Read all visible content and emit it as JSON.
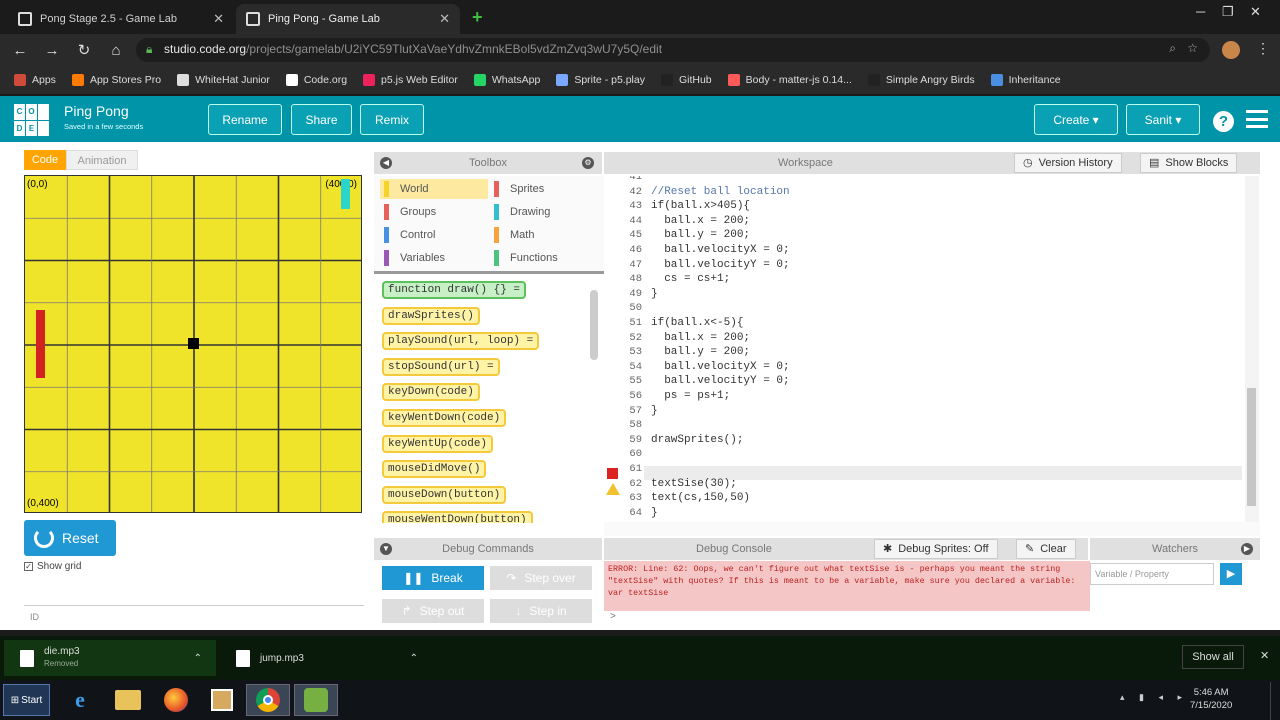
{
  "browser": {
    "tabs": [
      {
        "title": "Pong Stage 2.5 - Game Lab",
        "active": false
      },
      {
        "title": "Ping Pong - Game Lab",
        "active": true
      }
    ],
    "new_tab_label": "+",
    "url_host": "studio.code.org",
    "url_path": "/projects/gamelab/U2iYC59TlutXaVaeYdhvZmnkEBol5vdZmZvq3wU7y5Q/edit",
    "bookmarks": [
      {
        "label": "Apps",
        "icon": "apps-grid-icon",
        "color": "#d04a3a"
      },
      {
        "label": "App Stores Pro",
        "icon": "appstore-icon",
        "color": "#ff7a00"
      },
      {
        "label": "WhiteHat Junior",
        "icon": "whitehat-icon",
        "color": "#dddddd"
      },
      {
        "label": "Code.org",
        "icon": "codeorg-icon",
        "color": "#ffffff"
      },
      {
        "label": "p5.js Web Editor",
        "icon": "p5js-icon",
        "color": "#ed225d"
      },
      {
        "label": "WhatsApp",
        "icon": "whatsapp-icon",
        "color": "#25d366"
      },
      {
        "label": "Sprite - p5.play",
        "icon": "p5play-icon",
        "color": "#7aa7ff"
      },
      {
        "label": "GitHub",
        "icon": "github-icon",
        "color": "#222222"
      },
      {
        "label": "Body - matter-js 0.14...",
        "icon": "matterjs-icon",
        "color": "#ff5a5a"
      },
      {
        "label": "Simple Angry Birds",
        "icon": "github-icon",
        "color": "#222222"
      },
      {
        "label": "Inheritance",
        "icon": "inheritance-icon",
        "color": "#4a90e2"
      }
    ]
  },
  "header": {
    "project_name": "Ping Pong",
    "saved_status": "Saved in a few seconds",
    "buttons": {
      "rename": "Rename",
      "share": "Share",
      "remix": "Remix",
      "create": "Create ▾",
      "user": "Sanit ▾"
    },
    "help": "?",
    "logo_letters": [
      "C",
      "O",
      "",
      "D",
      "E",
      ""
    ]
  },
  "left_panel": {
    "tabs": {
      "code": "Code",
      "animation": "Animation"
    },
    "coords": {
      "top_left": "(0,0)",
      "top_right": "(400,0)",
      "bottom_left": "(0,400)"
    },
    "reset_label": "Reset",
    "show_grid_label": "Show grid",
    "show_grid_checked": true,
    "id_icon": "ID"
  },
  "toolbox": {
    "title": "Toolbox",
    "categories": [
      {
        "label": "World",
        "color": "#f5d328",
        "selected": true
      },
      {
        "label": "Sprites",
        "color": "#e8605a"
      },
      {
        "label": "Groups",
        "color": "#e8605a"
      },
      {
        "label": "Drawing",
        "color": "#31bfcf"
      },
      {
        "label": "Control",
        "color": "#4a90e2"
      },
      {
        "label": "Math",
        "color": "#f5a33a"
      },
      {
        "label": "Variables",
        "color": "#9b59b6"
      },
      {
        "label": "Functions",
        "color": "#4dc381"
      }
    ],
    "blocks": [
      {
        "label": "function draw() {} =",
        "green": true
      },
      {
        "label": "drawSprites()"
      },
      {
        "label": "playSound(url, loop) ="
      },
      {
        "label": "stopSound(url) ="
      },
      {
        "label": "keyDown(code)"
      },
      {
        "label": "keyWentDown(code)"
      },
      {
        "label": "keyWentUp(code)"
      },
      {
        "label": "mouseDidMove()"
      },
      {
        "label": "mouseDown(button)"
      },
      {
        "label": "mouseWentDown(button)"
      }
    ]
  },
  "workspace": {
    "title": "Workspace",
    "version_history": "Version History",
    "show_blocks": "Show Blocks",
    "lines": [
      {
        "n": "41",
        "text": "",
        "cls": ""
      },
      {
        "n": "42",
        "text": "//Reset ball location",
        "cls": "comment"
      },
      {
        "n": "43",
        "text": "if(ball.x>405){",
        "cls": ""
      },
      {
        "n": "44",
        "text": "  ball.x = 200;",
        "cls": ""
      },
      {
        "n": "45",
        "text": "  ball.y = 200;",
        "cls": ""
      },
      {
        "n": "46",
        "text": "  ball.velocityX = 0;",
        "cls": ""
      },
      {
        "n": "47",
        "text": "  ball.velocityY = 0;",
        "cls": ""
      },
      {
        "n": "48",
        "text": "  cs = cs+1;",
        "cls": ""
      },
      {
        "n": "49",
        "text": "}",
        "cls": ""
      },
      {
        "n": "50",
        "text": "",
        "cls": ""
      },
      {
        "n": "51",
        "text": "if(ball.x<-5){",
        "cls": ""
      },
      {
        "n": "52",
        "text": "  ball.x = 200;",
        "cls": ""
      },
      {
        "n": "53",
        "text": "  ball.y = 200;",
        "cls": ""
      },
      {
        "n": "54",
        "text": "  ball.velocityX = 0;",
        "cls": ""
      },
      {
        "n": "55",
        "text": "  ball.velocityY = 0;",
        "cls": ""
      },
      {
        "n": "56",
        "text": "  ps = ps+1;",
        "cls": ""
      },
      {
        "n": "57",
        "text": "}",
        "cls": ""
      },
      {
        "n": "58",
        "text": "",
        "cls": ""
      },
      {
        "n": "59",
        "text": "drawSprites();",
        "cls": ""
      },
      {
        "n": "60",
        "text": "",
        "cls": ""
      },
      {
        "n": "61",
        "text": "",
        "cls": ""
      },
      {
        "n": "62",
        "text": "textSise(30);",
        "cls": ""
      },
      {
        "n": "63",
        "text": "text(cs,150,50)",
        "cls": ""
      },
      {
        "n": "64",
        "text": "}",
        "cls": ""
      },
      {
        "n": "65",
        "text": "",
        "cls": ""
      }
    ]
  },
  "debug": {
    "commands_title": "Debug Commands",
    "break": "Break",
    "step_over": "Step over",
    "step_out": "Step out",
    "step_in": "Step in",
    "console_title": "Debug Console",
    "debug_sprites": "Debug Sprites: Off",
    "clear": "Clear",
    "console_error": "ERROR: Line: 62: Oops, we can't figure out what textSise is - perhaps you meant the string \"textSise\" with quotes? If this is meant to be a variable, make sure you declared a variable: var textSise",
    "console_prompt": ">",
    "watchers_title": "Watchers",
    "watch_placeholder": "Variable / Property"
  },
  "downloads": {
    "items": [
      {
        "name": "die.mp3",
        "status": "Removed"
      },
      {
        "name": "jump.mp3",
        "status": ""
      }
    ],
    "show_all": "Show all"
  },
  "taskbar": {
    "start": "Start",
    "time": "5:46 AM",
    "date": "7/15/2020",
    "apps": [
      "ie-icon",
      "explorer-icon",
      "firefox-icon",
      "media-icon",
      "chrome-icon",
      "gamelab-icon"
    ]
  },
  "colors": {
    "header": "#0094a8",
    "canvas": "#f0e42a",
    "accent": "#1f98d4",
    "paddle_left": "#d22222",
    "paddle_right": "#2ad6c9",
    "error_bg": "#f5c6c6"
  }
}
